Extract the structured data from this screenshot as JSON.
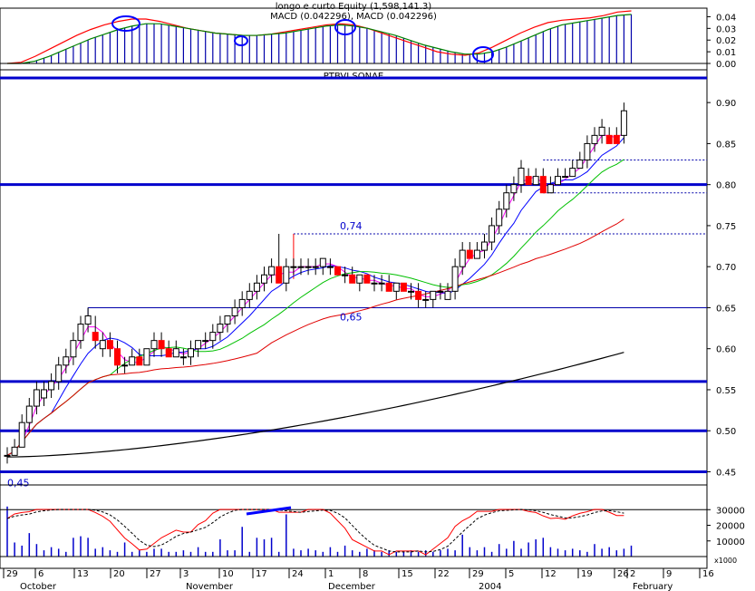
{
  "header": {
    "indicator_title": "longo e curto Equity (1,598,141.3)",
    "macd_label": "MACD (0.042296), MACD (0.042296)",
    "symbol": "PTBVI.SONAE"
  },
  "colors": {
    "candle_up": "#ffffff",
    "candle_down": "#ff0000",
    "ma_magenta": "#ff00ff",
    "ma_blue": "#0000ff",
    "ma_green": "#00c000",
    "ma_red": "#e00000",
    "ma_black": "#000000",
    "hlines": "#0000cc"
  },
  "chart_data": [
    {
      "type": "line",
      "panel": "macd",
      "yticks": [
        "0.04",
        "0.03",
        "0.02",
        "0.01",
        "0.00"
      ],
      "ylim": [
        0,
        0.045
      ],
      "series": [
        {
          "values": [
            0,
            0.001,
            0.006,
            0.012,
            0.018,
            0.024,
            0.029,
            0.033,
            0.036,
            0.038,
            0.038,
            0.036,
            0.033,
            0.03,
            0.028,
            0.026,
            0.025,
            0.024,
            0.024,
            0.025,
            0.027,
            0.029,
            0.031,
            0.033,
            0.034,
            0.033,
            0.03,
            0.026,
            0.022,
            0.018,
            0.014,
            0.01,
            0.008,
            0.007,
            0.009,
            0.014,
            0.02,
            0.026,
            0.031,
            0.035,
            0.037,
            0.038,
            0.039,
            0.041,
            0.044,
            0.045
          ]
        },
        {
          "values": [
            0,
            0,
            0.002,
            0.006,
            0.011,
            0.016,
            0.021,
            0.025,
            0.029,
            0.032,
            0.034,
            0.034,
            0.032,
            0.03,
            0.028,
            0.026,
            0.025,
            0.024,
            0.024,
            0.025,
            0.026,
            0.028,
            0.03,
            0.032,
            0.033,
            0.032,
            0.03,
            0.027,
            0.024,
            0.02,
            0.016,
            0.013,
            0.01,
            0.008,
            0.008,
            0.01,
            0.014,
            0.019,
            0.024,
            0.029,
            0.033,
            0.035,
            0.037,
            0.039,
            0.041,
            0.042
          ]
        }
      ]
    },
    {
      "type": "candlestick",
      "panel": "price",
      "yticks": [
        "0.90",
        "0.85",
        "0.80",
        "0.75",
        "0.70",
        "0.65",
        "0.60",
        "0.55",
        "0.50",
        "0.45"
      ],
      "ylim": [
        0.445,
        0.93
      ],
      "x_day_labels": [
        "29",
        "6",
        "13",
        "20",
        "27",
        "3",
        "10",
        "17",
        "24",
        "1",
        "8",
        "15",
        "22",
        "29",
        "5",
        "12",
        "19",
        "26",
        "2",
        "9",
        "16"
      ],
      "x_month_labels": [
        "October",
        "November",
        "December",
        "2004",
        "February"
      ],
      "annotations": [
        "0,45",
        "0,65",
        "0,74"
      ],
      "horizontal_levels": [
        0.93,
        0.8,
        0.56,
        0.5,
        0.45
      ],
      "resistance_lines": [
        {
          "value": 0.65,
          "label": "0,65"
        },
        {
          "value": 0.74,
          "label": "0,74"
        }
      ],
      "candles": [
        [
          0.47,
          0.48,
          0.46,
          0.47
        ],
        [
          0.47,
          0.49,
          0.47,
          0.48
        ],
        [
          0.48,
          0.52,
          0.48,
          0.51
        ],
        [
          0.51,
          0.54,
          0.5,
          0.53
        ],
        [
          0.53,
          0.56,
          0.52,
          0.55
        ],
        [
          0.54,
          0.56,
          0.53,
          0.55
        ],
        [
          0.55,
          0.57,
          0.54,
          0.56
        ],
        [
          0.56,
          0.59,
          0.55,
          0.58
        ],
        [
          0.58,
          0.6,
          0.57,
          0.59
        ],
        [
          0.59,
          0.62,
          0.58,
          0.61
        ],
        [
          0.61,
          0.64,
          0.6,
          0.63
        ],
        [
          0.63,
          0.65,
          0.62,
          0.64
        ],
        [
          0.62,
          0.64,
          0.6,
          0.61
        ],
        [
          0.6,
          0.62,
          0.59,
          0.61
        ],
        [
          0.61,
          0.62,
          0.59,
          0.6
        ],
        [
          0.6,
          0.61,
          0.57,
          0.58
        ],
        [
          0.58,
          0.59,
          0.57,
          0.58
        ],
        [
          0.58,
          0.6,
          0.58,
          0.59
        ],
        [
          0.59,
          0.6,
          0.58,
          0.58
        ],
        [
          0.58,
          0.6,
          0.58,
          0.6
        ],
        [
          0.6,
          0.62,
          0.59,
          0.61
        ],
        [
          0.61,
          0.62,
          0.59,
          0.6
        ],
        [
          0.6,
          0.61,
          0.59,
          0.59
        ],
        [
          0.59,
          0.61,
          0.59,
          0.6
        ],
        [
          0.59,
          0.6,
          0.58,
          0.59
        ],
        [
          0.59,
          0.61,
          0.58,
          0.6
        ],
        [
          0.6,
          0.61,
          0.59,
          0.61
        ],
        [
          0.61,
          0.62,
          0.6,
          0.61
        ],
        [
          0.61,
          0.63,
          0.6,
          0.62
        ],
        [
          0.62,
          0.64,
          0.61,
          0.63
        ],
        [
          0.63,
          0.64,
          0.62,
          0.64
        ],
        [
          0.64,
          0.66,
          0.63,
          0.65
        ],
        [
          0.65,
          0.67,
          0.64,
          0.66
        ],
        [
          0.66,
          0.68,
          0.65,
          0.67
        ],
        [
          0.67,
          0.69,
          0.66,
          0.68
        ],
        [
          0.68,
          0.7,
          0.67,
          0.69
        ],
        [
          0.69,
          0.71,
          0.68,
          0.7
        ],
        [
          0.7,
          0.74,
          0.68,
          0.68
        ],
        [
          0.68,
          0.71,
          0.67,
          0.7
        ],
        [
          0.7,
          0.71,
          0.69,
          0.7
        ],
        [
          0.7,
          0.71,
          0.69,
          0.7
        ],
        [
          0.7,
          0.71,
          0.69,
          0.7
        ],
        [
          0.7,
          0.71,
          0.69,
          0.7
        ],
        [
          0.7,
          0.71,
          0.69,
          0.71
        ],
        [
          0.7,
          0.71,
          0.69,
          0.7
        ],
        [
          0.7,
          0.7,
          0.69,
          0.69
        ],
        [
          0.69,
          0.7,
          0.68,
          0.69
        ],
        [
          0.69,
          0.7,
          0.68,
          0.68
        ],
        [
          0.68,
          0.69,
          0.67,
          0.69
        ],
        [
          0.69,
          0.69,
          0.68,
          0.68
        ],
        [
          0.68,
          0.69,
          0.67,
          0.68
        ],
        [
          0.68,
          0.69,
          0.67,
          0.68
        ],
        [
          0.68,
          0.69,
          0.67,
          0.67
        ],
        [
          0.67,
          0.68,
          0.66,
          0.68
        ],
        [
          0.68,
          0.68,
          0.67,
          0.67
        ],
        [
          0.67,
          0.68,
          0.66,
          0.67
        ],
        [
          0.67,
          0.68,
          0.65,
          0.66
        ],
        [
          0.66,
          0.67,
          0.65,
          0.66
        ],
        [
          0.66,
          0.67,
          0.65,
          0.67
        ],
        [
          0.67,
          0.68,
          0.66,
          0.67
        ],
        [
          0.66,
          0.68,
          0.66,
          0.67
        ],
        [
          0.67,
          0.71,
          0.66,
          0.7
        ],
        [
          0.7,
          0.73,
          0.69,
          0.72
        ],
        [
          0.72,
          0.73,
          0.71,
          0.71
        ],
        [
          0.71,
          0.73,
          0.71,
          0.72
        ],
        [
          0.72,
          0.74,
          0.71,
          0.73
        ],
        [
          0.73,
          0.76,
          0.72,
          0.75
        ],
        [
          0.75,
          0.78,
          0.74,
          0.77
        ],
        [
          0.77,
          0.8,
          0.76,
          0.79
        ],
        [
          0.79,
          0.81,
          0.78,
          0.8
        ],
        [
          0.8,
          0.83,
          0.79,
          0.82
        ],
        [
          0.81,
          0.82,
          0.8,
          0.8
        ],
        [
          0.8,
          0.82,
          0.8,
          0.81
        ],
        [
          0.81,
          0.82,
          0.79,
          0.79
        ],
        [
          0.79,
          0.81,
          0.79,
          0.8
        ],
        [
          0.8,
          0.82,
          0.8,
          0.81
        ],
        [
          0.81,
          0.82,
          0.81,
          0.81
        ],
        [
          0.81,
          0.83,
          0.81,
          0.82
        ],
        [
          0.82,
          0.84,
          0.82,
          0.83
        ],
        [
          0.83,
          0.86,
          0.82,
          0.85
        ],
        [
          0.85,
          0.87,
          0.84,
          0.86
        ],
        [
          0.86,
          0.88,
          0.85,
          0.87
        ],
        [
          0.86,
          0.87,
          0.85,
          0.85
        ],
        [
          0.86,
          0.87,
          0.85,
          0.85
        ],
        [
          0.86,
          0.9,
          0.85,
          0.89
        ]
      ]
    },
    {
      "type": "bar",
      "panel": "volume",
      "yticks": [
        "30000",
        "20000",
        "10000"
      ],
      "unit_label": "x1000",
      "ylim": [
        0,
        40000
      ],
      "values": [
        32000,
        9000,
        7000,
        15000,
        8000,
        4000,
        6000,
        5000,
        3000,
        12000,
        13000,
        12000,
        5000,
        6000,
        4000,
        3000,
        9000,
        3000,
        4000,
        3000,
        5000,
        5000,
        3000,
        3000,
        4000,
        3000,
        6000,
        3000,
        3000,
        11000,
        4000,
        4000,
        19000,
        3000,
        12000,
        11000,
        12000,
        3000,
        27000,
        5000,
        4000,
        5000,
        4000,
        3000,
        6000,
        3000,
        7000,
        4000,
        3000,
        5000,
        4000,
        3000,
        4000,
        3000,
        3000,
        4000,
        3000,
        4000,
        3000,
        4000,
        5000,
        4000,
        14000,
        6000,
        4000,
        6000,
        3000,
        8000,
        5000,
        10000,
        5000,
        9000,
        11000,
        12000,
        6000,
        5000,
        4000,
        5000,
        4000,
        3000,
        8000,
        5000,
        6000,
        4000,
        5000,
        7000
      ]
    }
  ]
}
